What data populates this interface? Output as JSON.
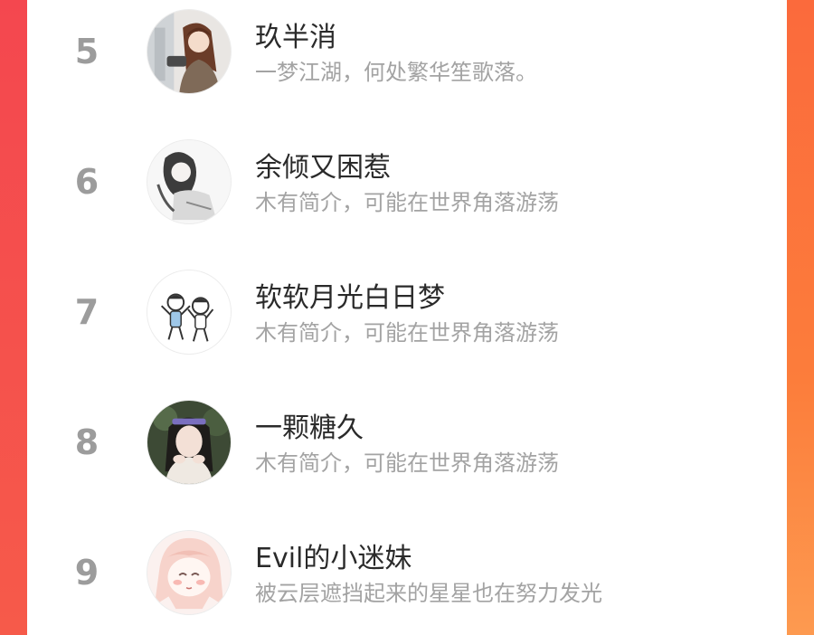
{
  "ranking": {
    "items": [
      {
        "rank": "5",
        "name": "玖半消",
        "bio": "一梦江湖，何处繁华笙歌落。",
        "avatar": "anime-girl-avatar-icon"
      },
      {
        "rank": "6",
        "name": "余倾又困惹",
        "bio": "木有简介，可能在世界角落游荡",
        "avatar": "sketch-girl-avatar-icon"
      },
      {
        "rank": "7",
        "name": "软软月光白日梦",
        "bio": "木有简介，可能在世界角落游荡",
        "avatar": "cartoon-kids-avatar-icon"
      },
      {
        "rank": "8",
        "name": "一颗糖久",
        "bio": "木有简介，可能在世界角落游荡",
        "avatar": "photo-girl-avatar-icon"
      },
      {
        "rank": "9",
        "name": "Evil的小迷妹",
        "bio": "被云层遮挡起来的星星也在努力发光",
        "avatar": "pink-anime-avatar-icon"
      }
    ]
  },
  "colors": {
    "border_left": "#f4474f",
    "border_right": "#fc7d3b",
    "rank_gray": "#9c9c9c",
    "name_text": "#2a2a2a",
    "bio_text": "#a3a3a3"
  }
}
